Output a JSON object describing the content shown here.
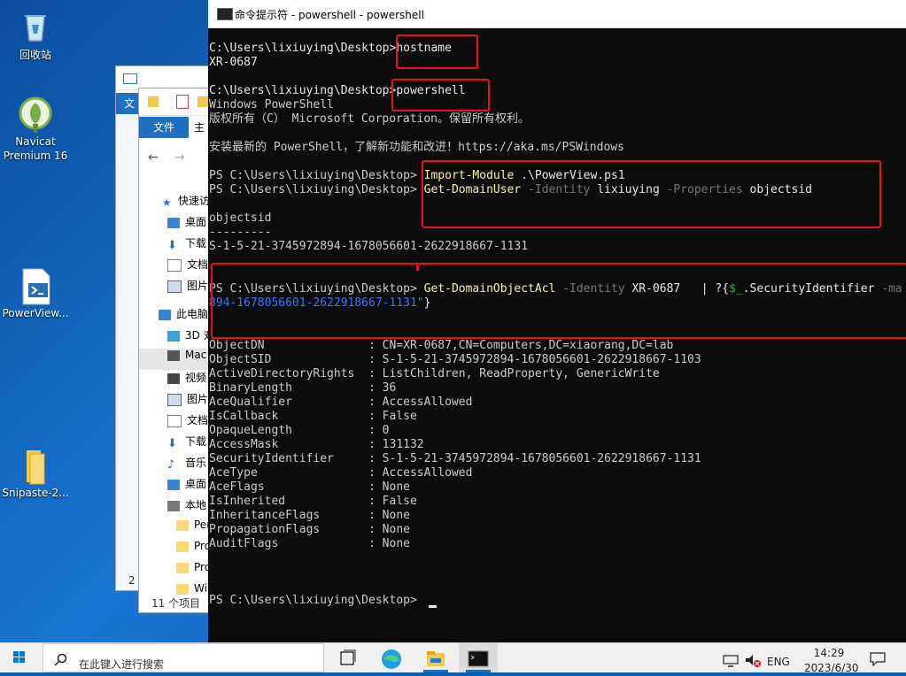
{
  "desktop_icons": [
    {
      "label": "回收站",
      "icon": "recycle-bin-icon"
    },
    {
      "label": "Navicat Premium 16",
      "icon": "navicat-icon"
    },
    {
      "label": "PowerView...",
      "icon": "powershell-script-icon"
    },
    {
      "label": "Snipaste-2...",
      "icon": "folder-icon"
    }
  ],
  "explorer_back": {
    "ribbon_tab": "文",
    "status_fragment": "2"
  },
  "explorer_front": {
    "ribbon_tabs": [
      "文件",
      "主"
    ],
    "quick_access": "快速访",
    "items": [
      "桌面",
      "下载",
      "文档",
      "图片",
      "此电脑",
      "3D 对",
      "Mac",
      "视频",
      "图片",
      "文档",
      "下载",
      "音乐",
      "桌面",
      "本地",
      "Per",
      "Pro",
      "Pro",
      "Wi"
    ],
    "status": "11 个项目"
  },
  "console": {
    "title": "命令提示符 - powershell - powershell",
    "lines": [
      {
        "row": 0,
        "segs": [
          {
            "t": "C:\\Users\\lixiuying\\Desktop>hostname",
            "c": "c-wht"
          }
        ]
      },
      {
        "row": 1,
        "segs": [
          {
            "t": "XR-0687",
            "c": "c-wht"
          }
        ]
      },
      {
        "row": 3,
        "segs": [
          {
            "t": "C:\\Users\\lixiuying\\Desktop>powershell",
            "c": "c-wht"
          }
        ]
      },
      {
        "row": 4,
        "segs": [
          {
            "t": "Windows PowerShell",
            "c": ""
          }
        ]
      },
      {
        "row": 5,
        "segs": [
          {
            "t": "版权所有（C） Microsoft Corporation。保留所有权利。",
            "c": ""
          }
        ]
      },
      {
        "row": 7,
        "segs": [
          {
            "t": "安装最新的 PowerShell，了解新功能和改进！https://aka.ms/PSWindows",
            "c": ""
          }
        ]
      },
      {
        "row": 9,
        "segs": [
          {
            "t": "PS C:\\Users\\lixiuying\\Desktop> ",
            "c": ""
          },
          {
            "t": "Import-Module",
            "c": "c-yel"
          },
          {
            "t": " .\\PowerView.ps1",
            "c": "c-wht"
          }
        ]
      },
      {
        "row": 10,
        "segs": [
          {
            "t": "PS C:\\Users\\lixiuying\\Desktop> ",
            "c": ""
          },
          {
            "t": "Get-DomainUser",
            "c": "c-yel"
          },
          {
            "t": " -Identity",
            "c": "c-gray"
          },
          {
            "t": " lixiuying",
            "c": "c-wht"
          },
          {
            "t": " -Properties",
            "c": "c-gray"
          },
          {
            "t": " objectsid",
            "c": "c-wht"
          }
        ]
      },
      {
        "row": 12,
        "segs": [
          {
            "t": "objectsid",
            "c": ""
          }
        ]
      },
      {
        "row": 13,
        "segs": [
          {
            "t": "---------",
            "c": ""
          }
        ]
      },
      {
        "row": 14,
        "segs": [
          {
            "t": "S-1-5-21-3745972894-1678056601-2622918667-1131",
            "c": ""
          }
        ]
      },
      {
        "row": 17,
        "segs": [
          {
            "t": "PS C:\\Users\\lixiuying\\Desktop> ",
            "c": ""
          },
          {
            "t": "Get-DomainObjectAcl",
            "c": "c-yel"
          },
          {
            "t": " -Identity",
            "c": "c-gray"
          },
          {
            "t": " XR-0687  ",
            "c": "c-wht"
          },
          {
            "t": " | ?{",
            "c": "c-wht"
          },
          {
            "t": "$_",
            "c": "c-grn"
          },
          {
            "t": ".SecurityIdentifier ",
            "c": "c-wht"
          },
          {
            "t": "-ma",
            "c": "c-gray"
          }
        ]
      },
      {
        "row": 18,
        "segs": [
          {
            "t": "894-1678056601-2622918667-1131\"",
            "c": "c-blu"
          },
          {
            "t": "}",
            "c": "c-wht"
          }
        ]
      },
      {
        "row": 21,
        "segs": [
          {
            "t": "ObjectDN               : CN=XR-0687,CN=Computers,DC=xiaorang,DC=lab",
            "c": ""
          }
        ]
      },
      {
        "row": 22,
        "segs": [
          {
            "t": "ObjectSID              : S-1-5-21-3745972894-1678056601-2622918667-1103",
            "c": ""
          }
        ]
      },
      {
        "row": 23,
        "segs": [
          {
            "t": "ActiveDirectoryRights  : ListChildren, ReadProperty, GenericWrite",
            "c": ""
          }
        ]
      },
      {
        "row": 24,
        "segs": [
          {
            "t": "BinaryLength           : 36",
            "c": ""
          }
        ]
      },
      {
        "row": 25,
        "segs": [
          {
            "t": "AceQualifier           : AccessAllowed",
            "c": ""
          }
        ]
      },
      {
        "row": 26,
        "segs": [
          {
            "t": "IsCallback             : False",
            "c": ""
          }
        ]
      },
      {
        "row": 27,
        "segs": [
          {
            "t": "OpaqueLength           : 0",
            "c": ""
          }
        ]
      },
      {
        "row": 28,
        "segs": [
          {
            "t": "AccessMask             : 131132",
            "c": ""
          }
        ]
      },
      {
        "row": 29,
        "segs": [
          {
            "t": "SecurityIdentifier     : S-1-5-21-3745972894-1678056601-2622918667-1131",
            "c": ""
          }
        ]
      },
      {
        "row": 30,
        "segs": [
          {
            "t": "AceType                : AccessAllowed",
            "c": ""
          }
        ]
      },
      {
        "row": 31,
        "segs": [
          {
            "t": "AceFlags               : None",
            "c": ""
          }
        ]
      },
      {
        "row": 32,
        "segs": [
          {
            "t": "IsInherited            : False",
            "c": ""
          }
        ]
      },
      {
        "row": 33,
        "segs": [
          {
            "t": "InheritanceFlags       : None",
            "c": ""
          }
        ]
      },
      {
        "row": 34,
        "segs": [
          {
            "t": "PropagationFlags       : None",
            "c": ""
          }
        ]
      },
      {
        "row": 35,
        "segs": [
          {
            "t": "AuditFlags             : None",
            "c": ""
          }
        ]
      },
      {
        "row": 39,
        "segs": [
          {
            "t": "PS C:\\Users\\lixiuying\\Desktop> ",
            "c": ""
          }
        ]
      }
    ]
  },
  "taskbar": {
    "search_placeholder": "在此键入进行搜索",
    "language": "ENG",
    "time": "14:29",
    "date": "2023/6/30",
    "icons": [
      "windows-start-icon",
      "task-view-icon",
      "edge-browser-icon",
      "file-explorer-icon",
      "cmd-icon"
    ]
  },
  "colors": {
    "annotation_red": "#e81123",
    "console_bg": "#0c0c0c",
    "command_yellow": "#f9f1a5",
    "param_gray": "#767676"
  }
}
